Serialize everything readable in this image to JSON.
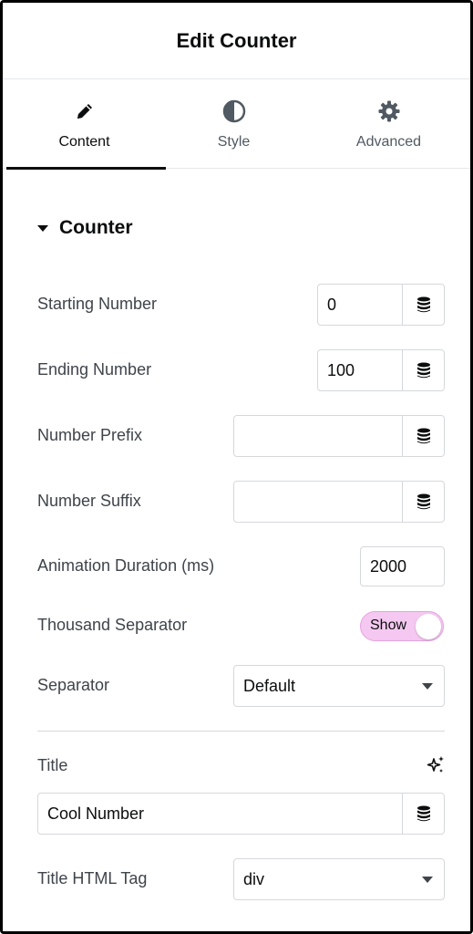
{
  "header": {
    "title": "Edit Counter"
  },
  "tabs": [
    {
      "label": "Content",
      "icon": "pencil-icon",
      "active": true
    },
    {
      "label": "Style",
      "icon": "contrast-icon",
      "active": false
    },
    {
      "label": "Advanced",
      "icon": "gear-icon",
      "active": false
    }
  ],
  "section": {
    "title": "Counter"
  },
  "fields": {
    "starting_number": {
      "label": "Starting Number",
      "value": "0"
    },
    "ending_number": {
      "label": "Ending Number",
      "value": "100"
    },
    "number_prefix": {
      "label": "Number Prefix",
      "value": ""
    },
    "number_suffix": {
      "label": "Number Suffix",
      "value": ""
    },
    "animation_duration": {
      "label": "Animation Duration (ms)",
      "value": "2000"
    },
    "thousand_separator": {
      "label": "Thousand Separator",
      "toggle_label": "Show",
      "enabled": true
    },
    "separator": {
      "label": "Separator",
      "value": "Default"
    },
    "title": {
      "label": "Title",
      "value": "Cool Number"
    },
    "title_html_tag": {
      "label": "Title HTML Tag",
      "value": "div"
    }
  },
  "colors": {
    "toggle_bg": "#f4c8f0",
    "active_tab_indicator": "#0c0d0e",
    "border": "#d5d8dc"
  }
}
